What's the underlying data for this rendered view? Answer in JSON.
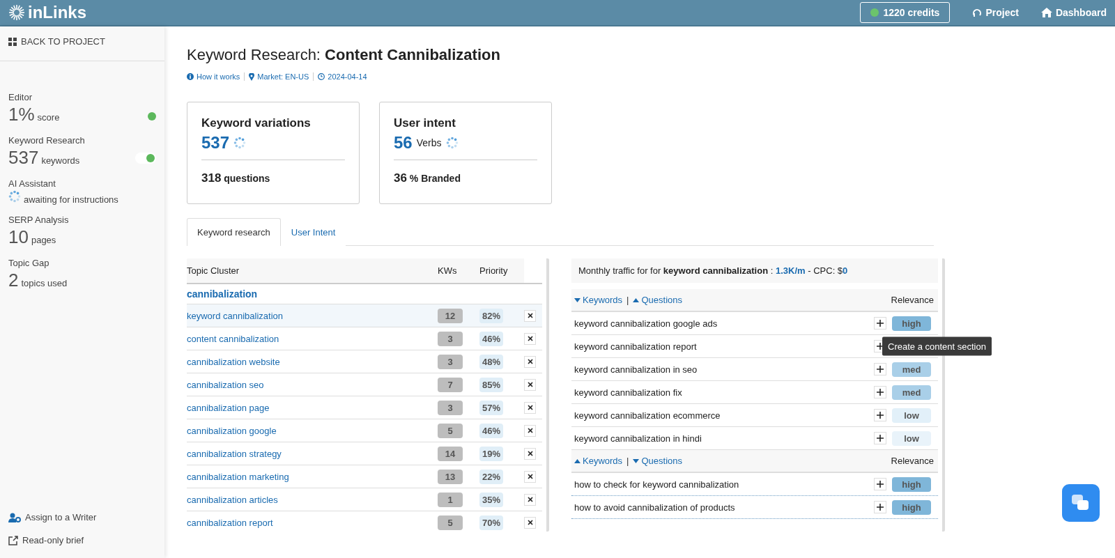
{
  "header": {
    "logo": "inLinks",
    "credits": "1220 credits",
    "nav": [
      "Project",
      "Dashboard"
    ]
  },
  "sidebar": {
    "back": "BACK TO PROJECT",
    "items": [
      {
        "kind": "dot",
        "label": "Editor",
        "value": "1%",
        "unit": "score",
        "color": "#5cb85c"
      },
      {
        "kind": "toggle",
        "label": "Keyword Research",
        "value": "537",
        "unit": "keywords",
        "on": true
      },
      {
        "kind": "spinner",
        "label": "AI Assistant",
        "unit": "awaiting for instructions"
      },
      {
        "kind": "plain",
        "label": "SERP Analysis",
        "value": "10",
        "unit": "pages"
      },
      {
        "kind": "plain",
        "label": "Topic Gap",
        "value": "2",
        "unit": "topics used"
      }
    ],
    "footer": [
      "Assign to a Writer",
      "Read-only brief"
    ]
  },
  "page": {
    "title_prefix": "Keyword Research:",
    "title": "Content Cannibalization",
    "meta": [
      "How it works",
      "Market: EN-US",
      "2024-04-14"
    ]
  },
  "cards": [
    {
      "title": "Keyword variations",
      "number": "537",
      "foot_number": "318",
      "foot_label": "questions"
    },
    {
      "title": "User intent",
      "number": "56",
      "number_unit": "Verbs",
      "foot_number": "36",
      "foot_label": "% Branded"
    }
  ],
  "tabs": [
    {
      "label": "Keyword research",
      "selected": true
    },
    {
      "label": "User Intent",
      "selected": false
    }
  ],
  "clusters": {
    "columns": [
      "Topic Cluster",
      "KWs",
      "Priority"
    ],
    "group": "cannibalization",
    "rows": [
      {
        "topic": "keyword cannibalization",
        "kws": "12",
        "priority": "82%",
        "selected": true
      },
      {
        "topic": "content cannibalization",
        "kws": "3",
        "priority": "46%",
        "selected": false
      },
      {
        "topic": "cannibalization website",
        "kws": "3",
        "priority": "48%",
        "selected": false
      },
      {
        "topic": "cannibalization seo",
        "kws": "7",
        "priority": "85%",
        "selected": false
      },
      {
        "topic": "cannibalization page",
        "kws": "3",
        "priority": "57%",
        "selected": false
      },
      {
        "topic": "cannibalization google",
        "kws": "5",
        "priority": "46%",
        "selected": false
      },
      {
        "topic": "cannibalization strategy",
        "kws": "14",
        "priority": "19%",
        "selected": false
      },
      {
        "topic": "cannibalization marketing",
        "kws": "13",
        "priority": "22%",
        "selected": false
      },
      {
        "topic": "cannibalization articles",
        "kws": "1",
        "priority": "35%",
        "selected": false
      },
      {
        "topic": "cannibalization report",
        "kws": "5",
        "priority": "70%",
        "selected": false
      }
    ]
  },
  "traffic": {
    "text": "Monthly traffic for for **keyword cannibalization** :",
    "volume": "1.3K/m",
    "cpc_label": "- CPC: $",
    "cpc": "0"
  },
  "keyword_sections": [
    {
      "tabs": [
        {
          "label": "Keywords",
          "expanded": true
        },
        {
          "label": "Questions",
          "expanded": false
        }
      ],
      "separator": "|",
      "relevance_label": "Relevance",
      "rows": [
        {
          "text": "keyword cannibalization google ads",
          "relevance": "high",
          "color": "#7fb6d9"
        },
        {
          "text": "keyword cannibalization report",
          "tooltip": "Create a content section"
        },
        {
          "text": "keyword cannibalization in seo",
          "relevance": "med",
          "color": "#a9cfe8"
        },
        {
          "text": "keyword cannibalization fix",
          "relevance": "med",
          "color": "#a9cfe8"
        },
        {
          "text": "keyword cannibalization ecommerce",
          "relevance": "low",
          "color": "#e2f0f9"
        },
        {
          "text": "keyword cannibalization in hindi",
          "relevance": "low",
          "color": "#e9f3fa"
        }
      ]
    },
    {
      "tabs": [
        {
          "label": "Keywords",
          "expanded": false
        },
        {
          "label": "Questions",
          "expanded": true
        }
      ],
      "separator": "|",
      "relevance_label": "Relevance",
      "rows": [
        {
          "text": "how to check for keyword cannibalization",
          "relevance": "high",
          "color": "#7fb6d9"
        },
        {
          "text": "how to avoid cannibalization of products",
          "relevance": "high",
          "color": "#7fb6d9"
        }
      ]
    }
  ]
}
